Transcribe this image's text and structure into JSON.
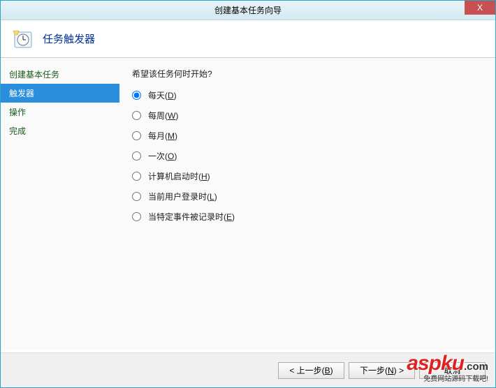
{
  "titlebar": {
    "title": "创建基本任务向导",
    "close": "X"
  },
  "header": {
    "title": "任务触发器"
  },
  "sidebar": {
    "items": [
      {
        "label": "创建基本任务",
        "active": false
      },
      {
        "label": "触发器",
        "active": true
      },
      {
        "label": "操作",
        "active": false
      },
      {
        "label": "完成",
        "active": false
      }
    ]
  },
  "main": {
    "prompt": "希望该任务何时开始?",
    "options": [
      {
        "label": "每天(D)",
        "checked": true
      },
      {
        "label": "每周(W)",
        "checked": false
      },
      {
        "label": "每月(M)",
        "checked": false
      },
      {
        "label": "一次(O)",
        "checked": false
      },
      {
        "label": "计算机启动时(H)",
        "checked": false
      },
      {
        "label": "当前用户登录时(L)",
        "checked": false
      },
      {
        "label": "当特定事件被记录时(E)",
        "checked": false
      }
    ]
  },
  "footer": {
    "back": "< 上一步(B)",
    "next": "下一步(N) >",
    "cancel": "取消"
  },
  "watermark": {
    "brand": "aspku",
    "tld": ".com",
    "sub": "免费网站源码下载吧!"
  }
}
